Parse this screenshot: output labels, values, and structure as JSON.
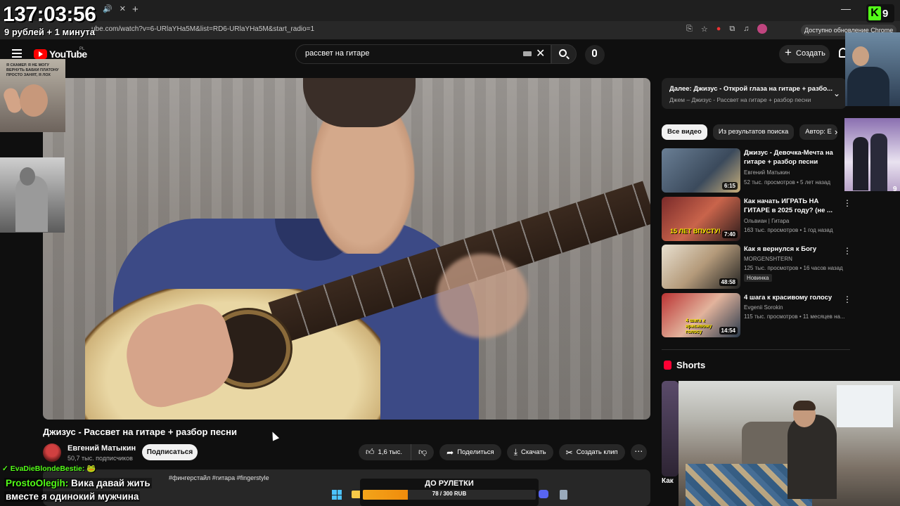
{
  "browser": {
    "url": "ube.com/watch?v=6-URlaYHa5M&list=RD6-URlaYHa5M&start_radio=1",
    "update_label": "Доступно обновление Chrome",
    "new_tab": "+",
    "minimize": "—"
  },
  "stream_overlay": {
    "timer": "137:03:56",
    "timer_sub": "9 рублей + 1 минута",
    "kick_letter": "K",
    "kick_count": "9",
    "cam1_text": "Я СКАМЕР. Я НЕ МОГУ ВЕРНУТЬ БАБКИ ПЛАТОНУ ПРОСТО ЗАНЯТ, Я ЛОХ",
    "cam4_num": "9"
  },
  "header": {
    "logo_text": "YouTube",
    "region": "PL",
    "search_value": "рассвет на гитаре",
    "create_label": "Создать"
  },
  "video": {
    "title": "Джизус - Рассвет на гитаре + разбор песни",
    "channel": "Евгений Матыкин",
    "subscribers": "50,7 тыс. подписчиков",
    "subscribe_label": "Подписаться",
    "likes": "1,6 тыс.",
    "share_label": "Поделиться",
    "download_label": "Скачать",
    "clip_label": "Создать клип",
    "description": "#фингерстайл #гитара #fingerstyle"
  },
  "sidebar": {
    "playlist_title": "Далее: Джизус - Открой глаза на гитаре + разбо...",
    "playlist_sub": "Джем – Джизус - Рассвет на гитаре + разбор песни",
    "chips": [
      "Все видео",
      "Из результатов поиска",
      "Автор: Е"
    ],
    "recommendations": [
      {
        "title": "Джизус - Девочка-Мечта на гитаре + разбор песни",
        "channel": "Евгений Матыкин",
        "meta": "52 тыс. просмотров • 5 лет назад",
        "duration": "6:15",
        "badge": ""
      },
      {
        "title": "Как начать ИГРАТЬ НА ГИТАРЕ в 2025 году? (не ...",
        "channel": "Ольвиан | Гитара",
        "meta": "163 тыс. просмотров • 1 год назад",
        "duration": "7:40",
        "badge": "",
        "thumb_text": "15 ЛЕТ ВПУСТУ!"
      },
      {
        "title": "Как я вернулся к Богу",
        "channel": "MORGENSHTERN",
        "meta": "125 тыс. просмотров • 16 часов назад",
        "duration": "48:58",
        "badge": "Новинка"
      },
      {
        "title": "4 шага к красивому голосу",
        "channel": "Evgenii Sorokin",
        "meta": "115 тыс. просмотров • 11 месяцев на...",
        "duration": "14:54",
        "badge": "",
        "thumb_text": "4 шага к красивому голосу"
      }
    ],
    "shorts_label": "Shorts",
    "shorts_caption": "Как"
  },
  "chat": {
    "msg1_user": "EvaDieBlondeBestie:",
    "msg2_user": "ProstoOlegih:",
    "msg2_text_line1": "Вика давай жить",
    "msg2_text_line2": "вместе я одинокий мужчина"
  },
  "donation": {
    "title": "ДО РУЛЕТКИ",
    "value_text": "78 / 300 RUB",
    "progress": 0.26
  },
  "colors": {
    "accent_red": "#ff0000",
    "kick_green": "#53fc18",
    "donation_orange": "#f3a41a"
  }
}
